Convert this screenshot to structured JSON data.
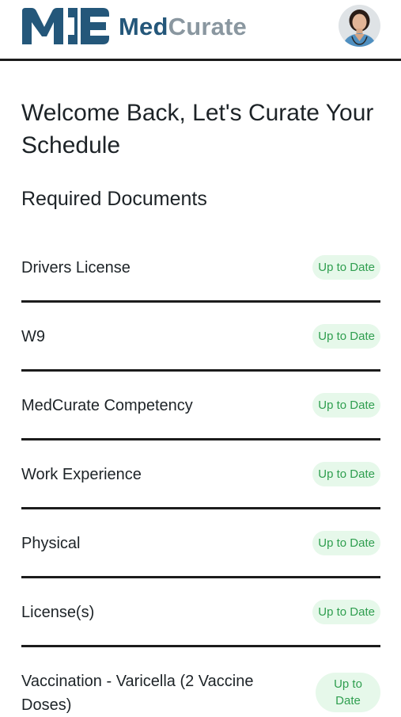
{
  "header": {
    "brand_part1": "Med",
    "brand_part2": "Curate",
    "logo_icon": "medcurate-logo-mark",
    "avatar_icon": "user-avatar-nurse"
  },
  "welcome": {
    "heading": "Welcome Back, Let's Curate Your Schedule"
  },
  "documents": {
    "title": "Required Documents",
    "items": [
      {
        "name": "Drivers License",
        "status": "Up to Date"
      },
      {
        "name": "W9",
        "status": "Up to Date"
      },
      {
        "name": "MedCurate Competency",
        "status": "Up to Date"
      },
      {
        "name": "Work Experience",
        "status": "Up to Date"
      },
      {
        "name": "Physical",
        "status": "Up to Date"
      },
      {
        "name": "License(s)",
        "status": "Up to Date"
      },
      {
        "name": "Vaccination - Varicella (2 Vaccine Doses)",
        "status": "Up to Date"
      }
    ]
  },
  "colors": {
    "brand_primary": "#24577a",
    "brand_secondary": "#8a97a0",
    "status_bg": "#e6f8ea",
    "status_text": "#2f9e4f",
    "divider": "#1c1c1c"
  }
}
